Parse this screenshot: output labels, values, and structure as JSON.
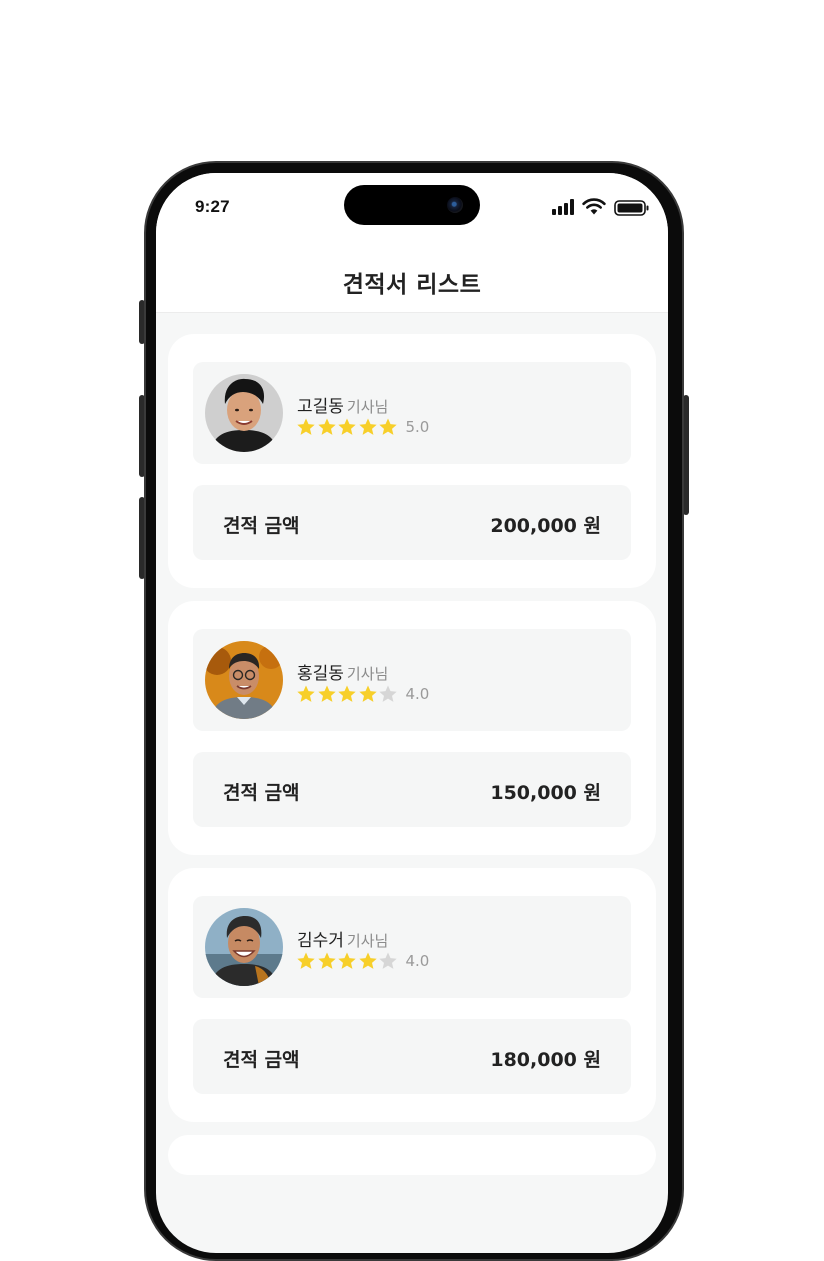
{
  "status_bar": {
    "time": "9:27",
    "icons": [
      "signal-icon",
      "wifi-icon",
      "battery-icon"
    ]
  },
  "header": {
    "title": "견적서 리스트"
  },
  "colors": {
    "star_filled": "#f7cf2a",
    "star_empty": "#d6d6d6",
    "background": "#f6f7f7"
  },
  "quotes": [
    {
      "name": "고길동",
      "suffix": "기사님",
      "rating": 5.0,
      "rating_text": "5.0",
      "price_label": "견적 금액",
      "price": "200,000 원"
    },
    {
      "name": "홍길동",
      "suffix": "기사님",
      "rating": 4.0,
      "rating_text": "4.0",
      "price_label": "견적 금액",
      "price": "150,000 원"
    },
    {
      "name": "김수거",
      "suffix": "기사님",
      "rating": 4.0,
      "rating_text": "4.0",
      "price_label": "견적 금액",
      "price": "180,000 원"
    }
  ]
}
